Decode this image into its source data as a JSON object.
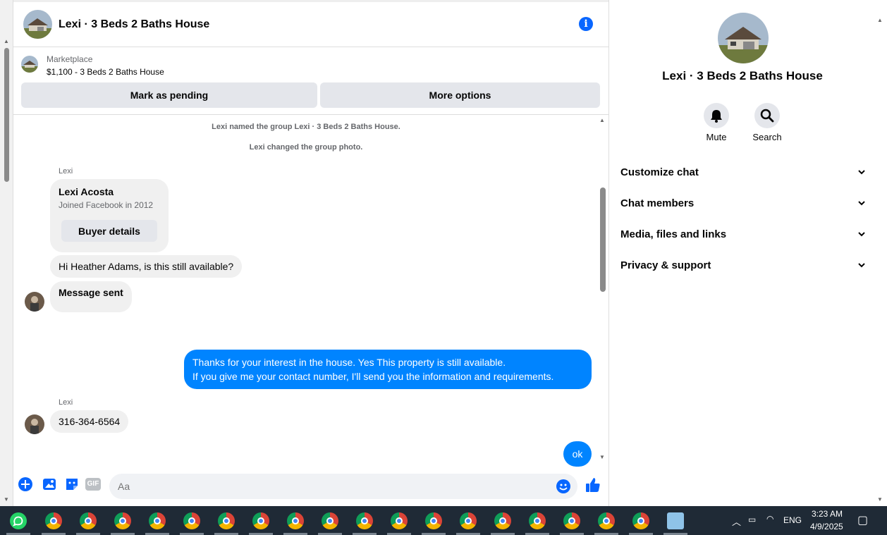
{
  "chat": {
    "title": "Lexi · 3 Beds 2 Baths House",
    "marketplace_label": "Marketplace",
    "listing": "$1,100 - 3 Beds 2 Baths House",
    "mark_pending": "Mark as pending",
    "more_options": "More options"
  },
  "messages": {
    "sys1": "Lexi named the group Lexi · 3 Beds 2 Baths House.",
    "sys2": "Lexi changed the group photo.",
    "sender1": "Lexi",
    "card_name": "Lexi Acosta",
    "card_joined": "Joined Facebook in 2012",
    "card_button": "Buyer details",
    "msg1": "Hi Heather Adams, is this still available?",
    "msg2": "Message sent",
    "out1_line1": "Thanks for your interest in the house. Yes This property is still available.",
    "out1_line2": "If you give me your contact number, I'll send you the information and requirements.",
    "sender2": "Lexi",
    "msg3": "316-364-6564",
    "out2": "ok"
  },
  "composer": {
    "placeholder": "Aa",
    "gif_label": "GIF"
  },
  "panel": {
    "name": "Lexi · 3 Beds 2 Baths House",
    "mute_label": "Mute",
    "search_label": "Search",
    "rows": [
      "Customize chat",
      "Chat members",
      "Media, files and links",
      "Privacy & support"
    ]
  },
  "taskbar": {
    "lang": "ENG",
    "time": "3:23 AM",
    "date": "4/9/2025"
  },
  "colors": {
    "accent": "#0866ff",
    "outgoing_bubble": "#0084ff",
    "incoming_bubble": "#f0f0f0"
  }
}
